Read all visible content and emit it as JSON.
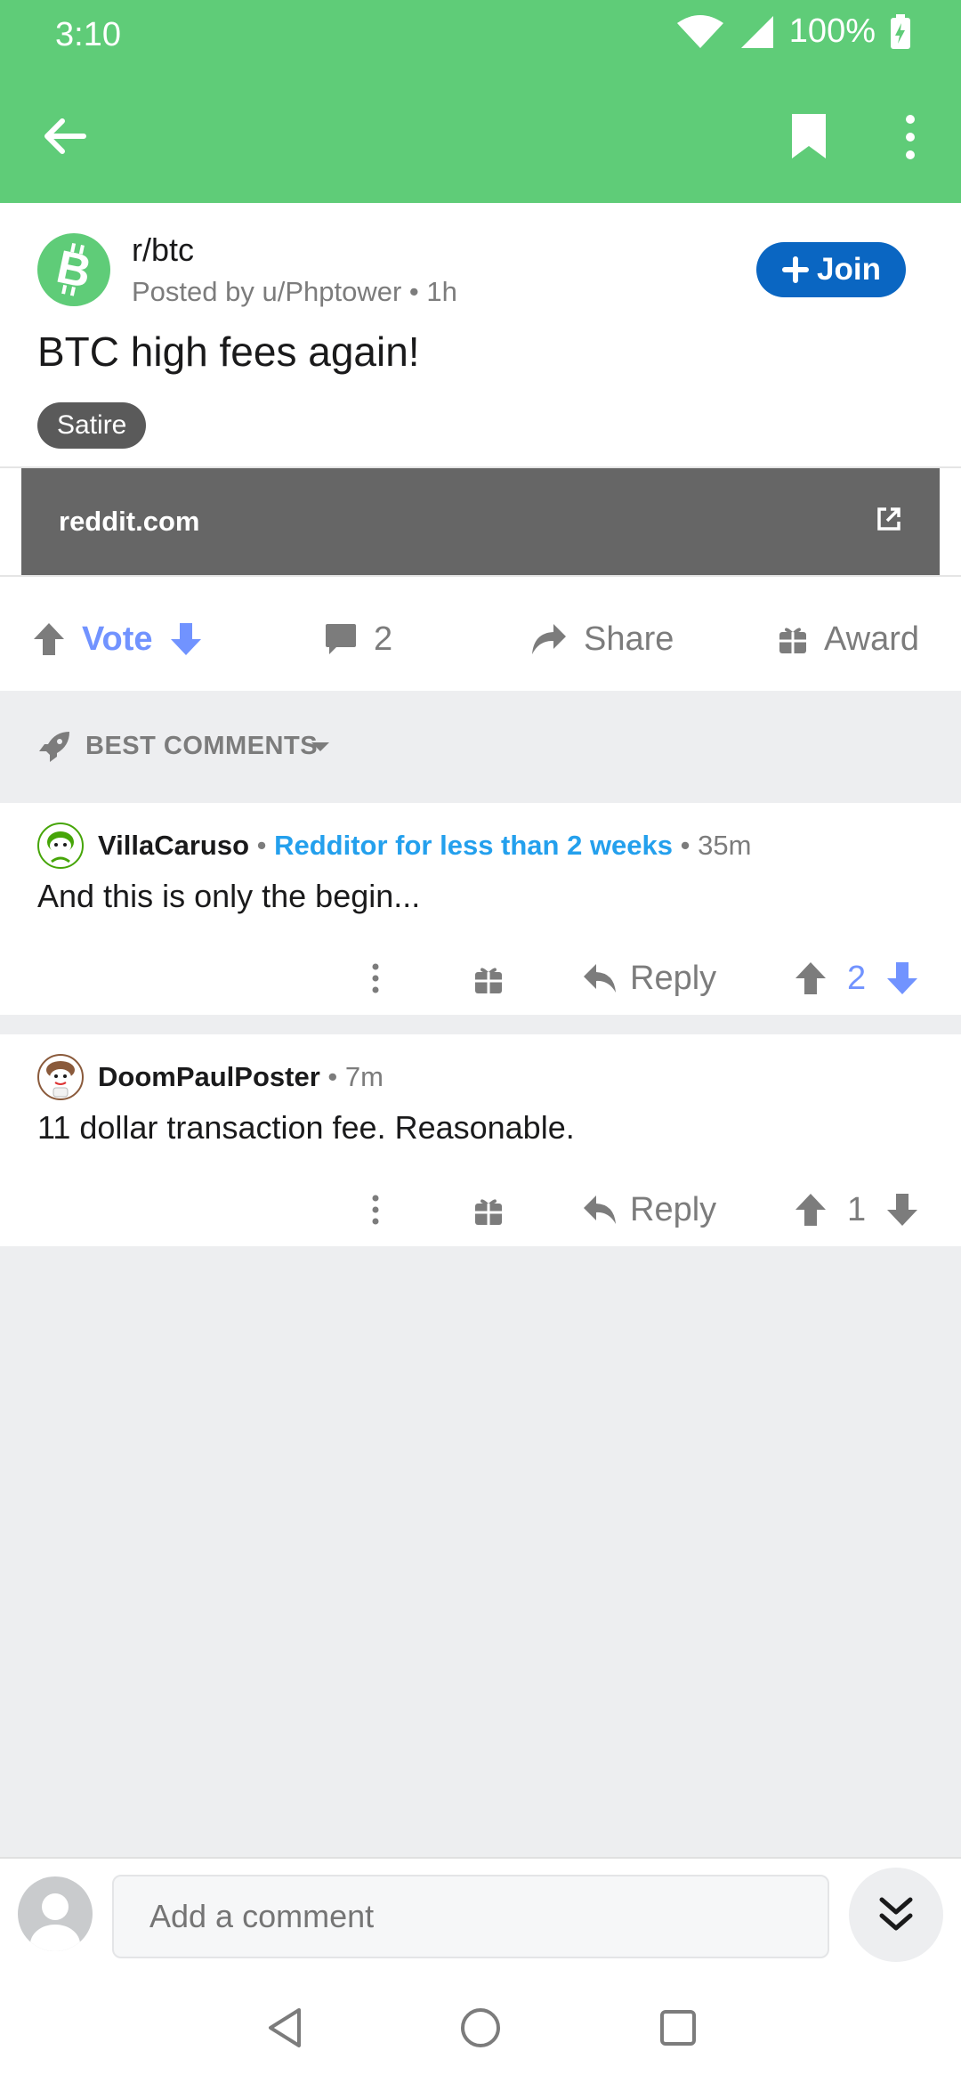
{
  "status_bar": {
    "time": "3:10",
    "battery": "100%"
  },
  "app_bar": {
    "back_icon": "arrow-left-icon",
    "bookmark_icon": "bookmark-icon",
    "more_icon": "more-vertical-icon"
  },
  "post": {
    "subreddit": "r/btc",
    "posted_by": "Posted by u/Phptower",
    "age": "1h",
    "title": "BTC high fees again!",
    "flair": "Satire",
    "join_label": "Join",
    "link_domain": "reddit.com",
    "vote_label": "Vote",
    "comment_count": "2",
    "share_label": "Share",
    "award_label": "Award"
  },
  "sort": {
    "label": "BEST COMMENTS"
  },
  "comments": [
    {
      "username": "VillaCaruso",
      "user_flair": "Redditor for less than 2 weeks",
      "age": "35m",
      "body": "And this is only the begin...",
      "reply_label": "Reply",
      "score": "2",
      "voted": "up"
    },
    {
      "username": "DoomPaulPoster",
      "age": "7m",
      "body": "11 dollar transaction fee. Reasonable.",
      "reply_label": "Reply",
      "score": "1",
      "voted": "none"
    }
  ],
  "composer": {
    "placeholder": "Add a comment"
  },
  "colors": {
    "app_bar": "#5fcc78",
    "join_button": "#0a66c2",
    "vote_active": "#7193ff",
    "flair_text": "#24a0ed"
  }
}
